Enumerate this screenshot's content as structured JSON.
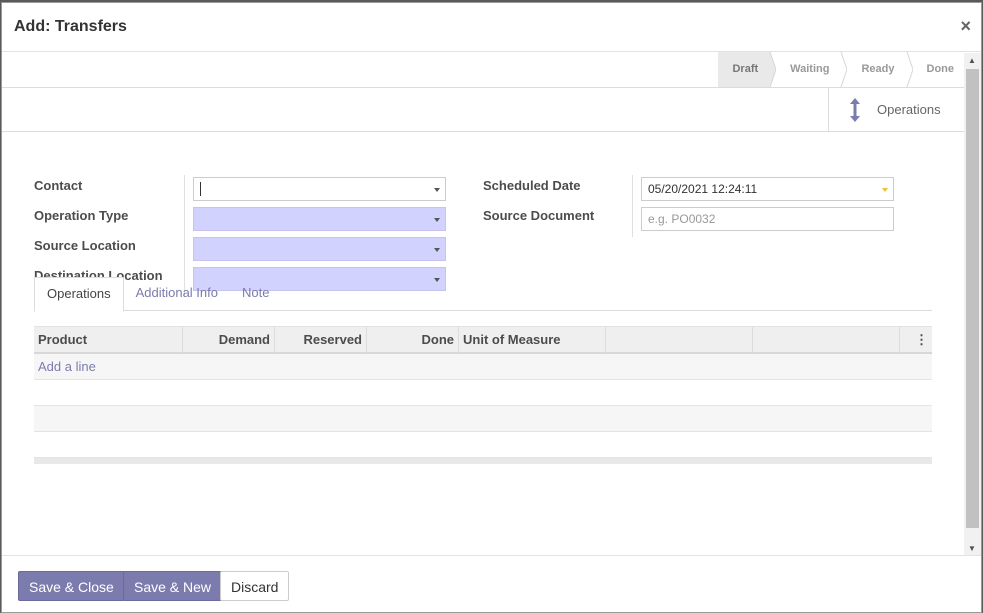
{
  "dialog": {
    "title": "Add: Transfers",
    "close_glyph": "×"
  },
  "status": {
    "stages": [
      "Draft",
      "Waiting",
      "Ready",
      "Done"
    ],
    "active_stage": "Draft"
  },
  "smart_button": {
    "label": "Operations",
    "icon": "arrows-v-icon"
  },
  "form": {
    "contact_label": "Contact",
    "contact_value": "",
    "operation_type_label": "Operation Type",
    "source_location_label": "Source Location",
    "destination_location_label": "Destination Location",
    "scheduled_date_label": "Scheduled Date",
    "scheduled_date_value": "05/20/2021 12:24:11",
    "source_document_label": "Source Document",
    "source_document_placeholder": "e.g. PO0032"
  },
  "tabs": [
    "Operations",
    "Additional Info",
    "Note"
  ],
  "table": {
    "columns": [
      "Product",
      "Demand",
      "Reserved",
      "Done",
      "Unit of Measure",
      "",
      ""
    ],
    "add_line": "Add a line",
    "options_glyph": "⋮"
  },
  "footer": {
    "save_close": "Save & Close",
    "save_new": "Save & New",
    "discard": "Discard"
  },
  "colors": {
    "accent": "#7c7bad",
    "required_field": "#d2d2ff"
  }
}
